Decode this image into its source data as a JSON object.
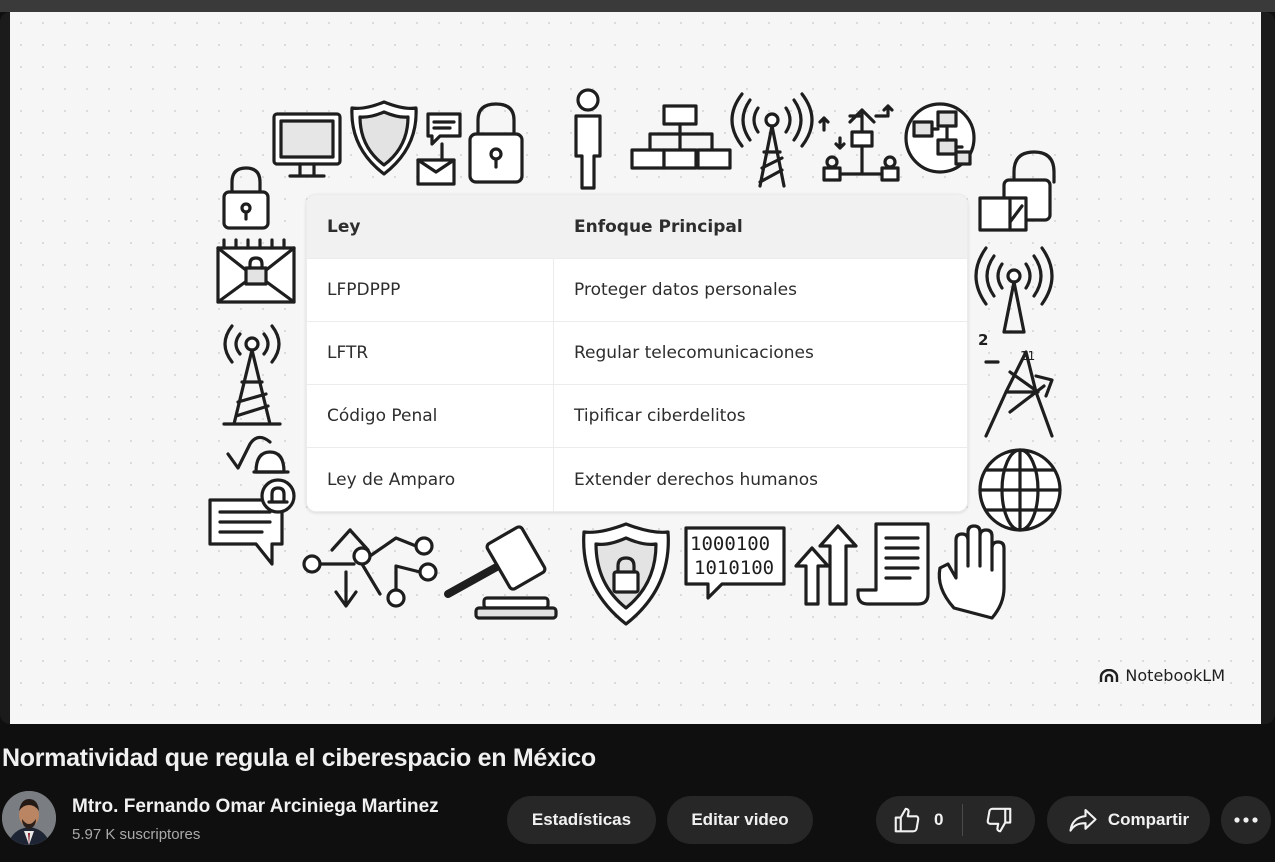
{
  "video": {
    "table": {
      "headers": [
        "Ley",
        "Enfoque Principal"
      ],
      "rows": [
        [
          "LFPDPPP",
          "Proteger datos personales"
        ],
        [
          "LFTR",
          "Regular telecomunicaciones"
        ],
        [
          "Código Penal",
          "Tipificar ciberdelitos"
        ],
        [
          "Ley de Amparo",
          "Extender derechos humanos"
        ]
      ]
    },
    "binary_lines": [
      "1000100",
      "1010100"
    ],
    "tower_numbers": [
      "2",
      "11"
    ],
    "brand": "NotebookLM"
  },
  "title": "Normatividad que regula el ciberespacio en México",
  "channel": {
    "name": "Mtro. Fernando Omar Arciniega Martinez",
    "subscribers": "5.97 K suscriptores"
  },
  "actions": {
    "stats_label": "Estadísticas",
    "edit_label": "Editar video",
    "like_count": "0",
    "share_label": "Compartir"
  },
  "icons": {
    "like": "thumbs-up-icon",
    "dislike": "thumbs-down-icon",
    "share": "share-arrow-icon",
    "more": "more-dots-icon"
  },
  "colors": {
    "page_bg": "#0f0f0f",
    "button_bg": "#272727",
    "slide_bg": "#f6f6f6",
    "secondary_text": "#aaaaaa"
  }
}
